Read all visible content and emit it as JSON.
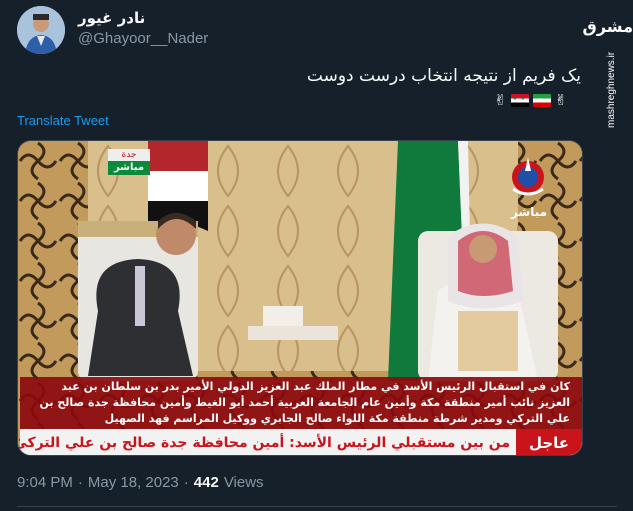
{
  "author": {
    "name": "نادر غيور",
    "handle": "@Ghayoor__Nader"
  },
  "watermark": {
    "logo": "مشرق",
    "url": "mashreghnews.ir"
  },
  "tweet": {
    "text": "یک فریم از نتیجه انتخاب درست دوست",
    "emoji_victory": "✌",
    "translate_label": "Translate Tweet"
  },
  "media": {
    "city_tag": "جدة",
    "live_tag": "مباشر",
    "channel_live": "مباشر",
    "caption": "كان في استقبال الرئيس الأسد في مطار الملك عبد العزيز الدولي الأمير بدر بن سلطان بن عبد العزيز نائب أمير منطقة مكة وأمين عام الجامعة العربية أحمد أبو الغيط وأمين محافظة جدة صالح بن علي التركي ومدير شرطة منطقة مكة اللواء صالح الجابري ووكيل المراسم فهد الصهيل",
    "ticker_label": "عاجل",
    "ticker_text": "من بين مستقبلي الرئيس الأسد:  أمين محافظة جدة صالح بن علي التركي"
  },
  "meta": {
    "time": "9:04 PM",
    "separator": "·",
    "date": "May 18, 2023",
    "views_count": "442",
    "views_label": "Views"
  },
  "colors": {
    "background": "#15202b",
    "link": "#1d9bf0",
    "secondary_text": "#8b98a5",
    "breaking_red": "#c9141c"
  }
}
